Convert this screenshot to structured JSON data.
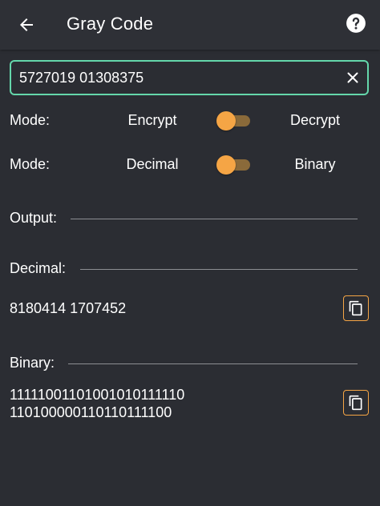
{
  "appbar": {
    "title": "Gray Code"
  },
  "input": {
    "value": "5727019 01308375"
  },
  "mode_rows": [
    {
      "label": "Mode:",
      "option_a": "Encrypt",
      "option_b": "Decrypt"
    },
    {
      "label": "Mode:",
      "option_a": "Decimal",
      "option_b": "Binary"
    }
  ],
  "output": {
    "label": "Output:"
  },
  "decimal": {
    "label": "Decimal:",
    "value": "8180414 1707452"
  },
  "binary": {
    "label": "Binary:",
    "line1": "11111001101001010111110",
    "line2": "110100000110110111100"
  },
  "colors": {
    "background": "#2b2d33",
    "appbar": "#2e3036",
    "accent_green": "#64d7ab",
    "accent_orange": "#f5a545"
  },
  "icons": {
    "back": "arrow-left-icon",
    "help": "help-circle-icon",
    "clear": "close-icon",
    "copy": "copy-icon"
  }
}
